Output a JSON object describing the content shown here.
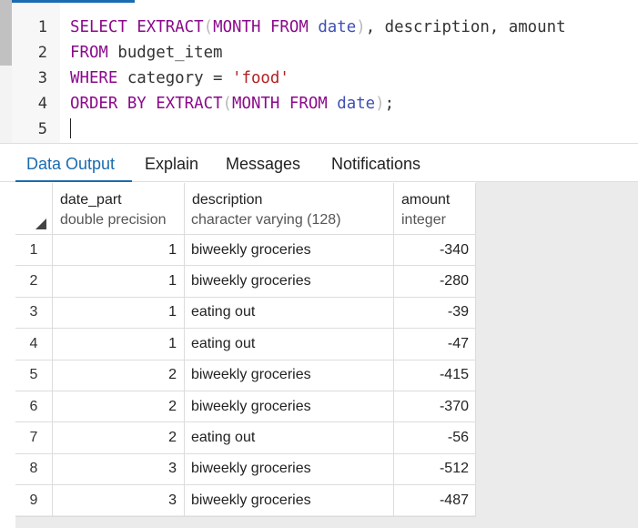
{
  "editor": {
    "line_numbers": [
      "1",
      "2",
      "3",
      "4",
      "5"
    ],
    "line1": {
      "kw_select": "SELECT",
      "kw_extract": "EXTRACT",
      "open_paren": "(",
      "kw_month": "MONTH",
      "kw_from": "FROM",
      "col_date": "date",
      "close_paren": ")",
      "rest": ", description, amount"
    },
    "line2": {
      "kw_from": "FROM",
      "table": " budget_item"
    },
    "line3": {
      "kw_where": "WHERE",
      "rest": " category = ",
      "string": "'food'"
    },
    "line4": {
      "kw_order_by": "ORDER BY",
      "kw_extract": "EXTRACT",
      "open_paren": "(",
      "kw_month": "MONTH",
      "kw_from": "FROM",
      "col_date": "date",
      "close_paren": ")",
      "semicolon": ";"
    }
  },
  "tabs": [
    {
      "label": "Data Output",
      "active": true
    },
    {
      "label": "Explain",
      "active": false
    },
    {
      "label": "Messages",
      "active": false
    },
    {
      "label": "Notifications",
      "active": false
    }
  ],
  "grid": {
    "columns": [
      {
        "name": "date_part",
        "type": "double precision"
      },
      {
        "name": "description",
        "type": "character varying (128)"
      },
      {
        "name": "amount",
        "type": "integer"
      }
    ],
    "rows": [
      {
        "idx": "1",
        "date_part": "1",
        "description": "biweekly groceries",
        "amount": "-340"
      },
      {
        "idx": "2",
        "date_part": "1",
        "description": "biweekly groceries",
        "amount": "-280"
      },
      {
        "idx": "3",
        "date_part": "1",
        "description": "eating out",
        "amount": "-39"
      },
      {
        "idx": "4",
        "date_part": "1",
        "description": "eating out",
        "amount": "-47"
      },
      {
        "idx": "5",
        "date_part": "2",
        "description": "biweekly groceries",
        "amount": "-415"
      },
      {
        "idx": "6",
        "date_part": "2",
        "description": "biweekly groceries",
        "amount": "-370"
      },
      {
        "idx": "7",
        "date_part": "2",
        "description": "eating out",
        "amount": "-56"
      },
      {
        "idx": "8",
        "date_part": "3",
        "description": "biweekly groceries",
        "amount": "-512"
      },
      {
        "idx": "9",
        "date_part": "3",
        "description": "biweekly groceries",
        "amount": "-487"
      }
    ]
  }
}
